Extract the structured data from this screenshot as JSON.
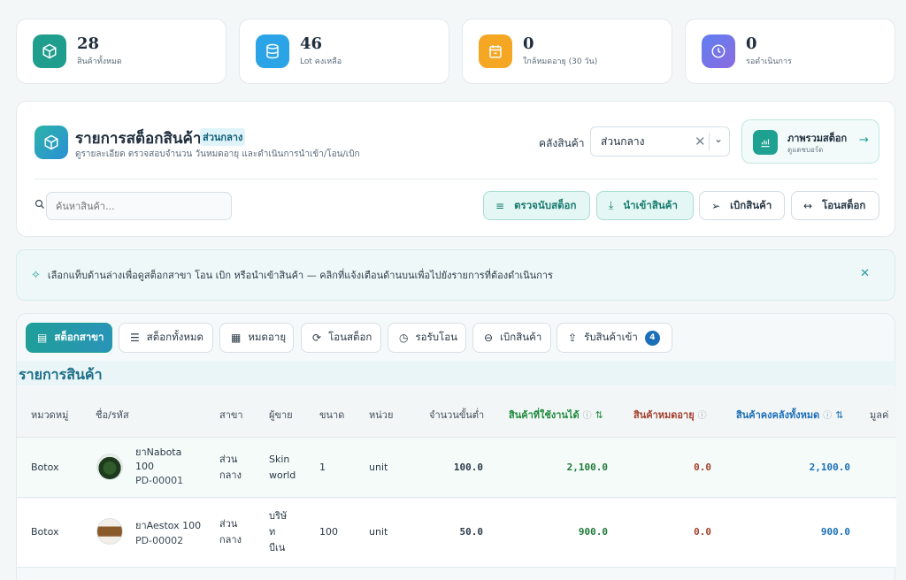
{
  "kpis": [
    {
      "value": "28",
      "label": "สินค้าทั้งหมด",
      "color": "#1f9e8e",
      "icon": "box-icon"
    },
    {
      "value": "46",
      "label": "Lot คงเหลือ",
      "color": "#2aa4e6",
      "icon": "database-icon"
    },
    {
      "value": "0",
      "label": "ใกล้หมดอายุ (30 วัน)",
      "color": "#f5a623",
      "icon": "calendar-icon"
    },
    {
      "value": "0",
      "label": "รอดำเนินการ",
      "color": "#6a7de8",
      "icon": "clock-icon"
    }
  ],
  "header": {
    "title": "รายการสต็อกสินค้า",
    "badge": "ส่วนกลาง",
    "subtitle": "ดูรายละเอียด ตรวจสอบจำนวน วันหมดอายุ และดำเนินการนำเข้า/โอน/เบิก",
    "warehouse_label": "คลังสินค้า",
    "warehouse_value": "ส่วนกลาง",
    "overview_title": "ภาพรวมสต็อก",
    "overview_sub": "ดูแดชบอร์ด",
    "search_placeholder": "ค้นหาสินค้า...",
    "actions": {
      "count": "ตรวจนับสต็อก",
      "import": "นำเข้าสินค้า",
      "withdraw": "เบิกสินค้า",
      "transfer": "โอนสต็อก"
    }
  },
  "notice": {
    "text": "เลือกแท็บด้านล่างเพื่อดูสต็อกสาขา โอน เบิก หรือนำเข้าสินค้า — คลิกที่แจ้งเตือนด้านบนเพื่อไปยังรายการที่ต้องดำเนินการ"
  },
  "tabs": [
    {
      "label": "สต็อกสาขา",
      "active": true
    },
    {
      "label": "สต็อกทั้งหมด"
    },
    {
      "label": "หมดอายุ"
    },
    {
      "label": "โอนสต็อก"
    },
    {
      "label": "รอรับโอน"
    },
    {
      "label": "เบิกสินค้า"
    },
    {
      "label": "รับสินค้าเข้า",
      "count": "4"
    }
  ],
  "table": {
    "title": "รายการสินค้า",
    "columns": {
      "category": "หมวดหมู่",
      "name": "ชื่อ/รหัส",
      "branch": "สาขา",
      "vendor": "ผู้ขาย",
      "size": "ขนาด",
      "unit": "หน่วย",
      "min": "จำนวนขั้นต่ำ",
      "usable": "สินค้าที่ใช้งานได้",
      "expired": "สินค้าหมดอายุ",
      "total": "สินค้าคงคลังทั้งหมด",
      "value": "มูลค่"
    },
    "rows": [
      {
        "category": "Botox",
        "name_l1": "ยาNabota",
        "name_l2": "100",
        "code": "PD-00001",
        "branch_l1": "ส่วน",
        "branch_l2": "กลาง",
        "vendor_l1": "Skin",
        "vendor_l2": "world",
        "vendor_l3": "",
        "size": "1",
        "unit": "unit",
        "min": "100.0",
        "usable": "2,100.0",
        "expired": "0.0",
        "total": "2,100.0"
      },
      {
        "category": "Botox",
        "name_l1": "ยาAestox 100",
        "name_l2": "",
        "code": "PD-00002",
        "branch_l1": "ส่วน",
        "branch_l2": "กลาง",
        "vendor_l1": "บริษั",
        "vendor_l2": "ท",
        "vendor_l3": "บีเน",
        "size": "100",
        "unit": "unit",
        "min": "50.0",
        "usable": "900.0",
        "expired": "0.0",
        "total": "900.0"
      }
    ]
  }
}
